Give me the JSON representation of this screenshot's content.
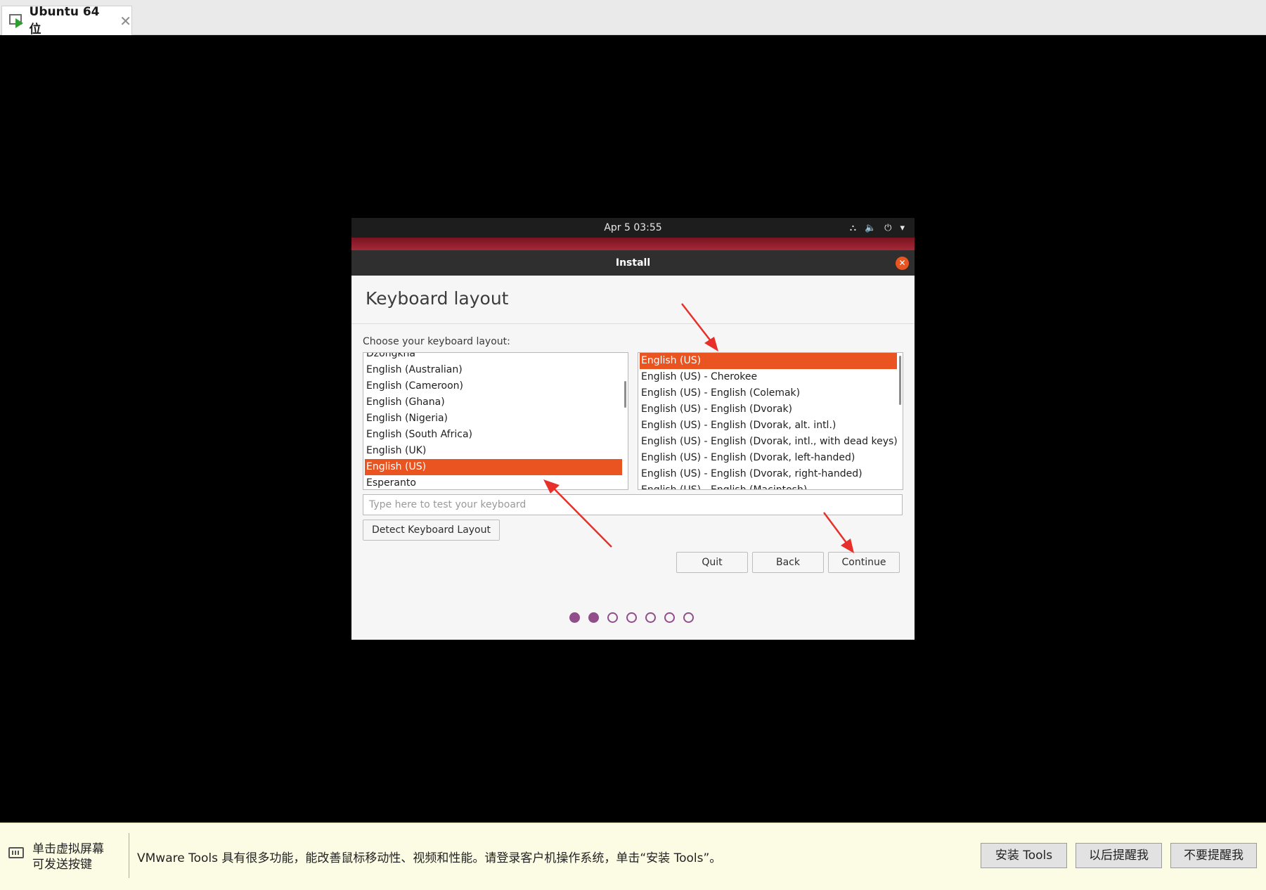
{
  "tab": {
    "title": "Ubuntu 64 位",
    "close": "✕"
  },
  "guest_topbar": {
    "clock": "Apr 5  03:55",
    "tray": {
      "network": "⛬",
      "volume": "🔈",
      "power": "⏻",
      "menu": "▾"
    }
  },
  "window": {
    "title": "Install",
    "close": "✕"
  },
  "page": {
    "title": "Keyboard layout",
    "choose_label": "Choose your keyboard layout:"
  },
  "left_list": {
    "items": [
      "Dzongkha",
      "English (Australian)",
      "English (Cameroon)",
      "English (Ghana)",
      "English (Nigeria)",
      "English (South Africa)",
      "English (UK)",
      "English (US)",
      "Esperanto"
    ],
    "selected_index": 7
  },
  "right_list": {
    "items": [
      "English (US)",
      "English (US) - Cherokee",
      "English (US) - English (Colemak)",
      "English (US) - English (Dvorak)",
      "English (US) - English (Dvorak, alt. intl.)",
      "English (US) - English (Dvorak, intl., with dead keys)",
      "English (US) - English (Dvorak, left-handed)",
      "English (US) - English (Dvorak, right-handed)",
      "English (US) - English (Macintosh)"
    ],
    "selected_index": 0
  },
  "test_input": {
    "placeholder": "Type here to test your keyboard",
    "value": ""
  },
  "buttons": {
    "detect": "Detect Keyboard Layout",
    "quit": "Quit",
    "back": "Back",
    "continue": "Continue"
  },
  "progress": {
    "total_steps": 7,
    "completed_steps": 2
  },
  "colors": {
    "accent": "#e95420",
    "step_dot": "#924d8b",
    "annotation_arrow": "#e8302a"
  },
  "vmware_bar": {
    "hint": "单击虚拟屏幕\n可发送按键",
    "message": "VMware Tools 具有很多功能，能改善鼠标移动性、视频和性能。请登录客户机操作系统，单击“安装 Tools”。",
    "install_button": "安装 Tools",
    "remind_later_button": "以后提醒我",
    "never_remind_button": "不要提醒我"
  }
}
